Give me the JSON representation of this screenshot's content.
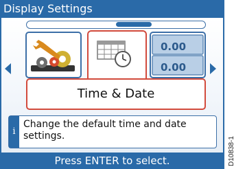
{
  "window": {
    "title": "Display Settings"
  },
  "carousel": {
    "items": [
      {
        "icon": "wrench-gears-icon"
      },
      {
        "icon": "calendar-clock-icon"
      },
      {
        "icon": "data-boxes-icon",
        "readouts": [
          "0.00",
          "0.00"
        ]
      }
    ],
    "selected_label": "Time & Date"
  },
  "help": {
    "info_glyph": "i",
    "text": "Change the default time and date settings."
  },
  "footer": {
    "prompt": "Press ENTER to select."
  },
  "document_id": "D10838-1",
  "colors": {
    "frame": "#2a6aa8",
    "highlight": "#d24a3c"
  }
}
